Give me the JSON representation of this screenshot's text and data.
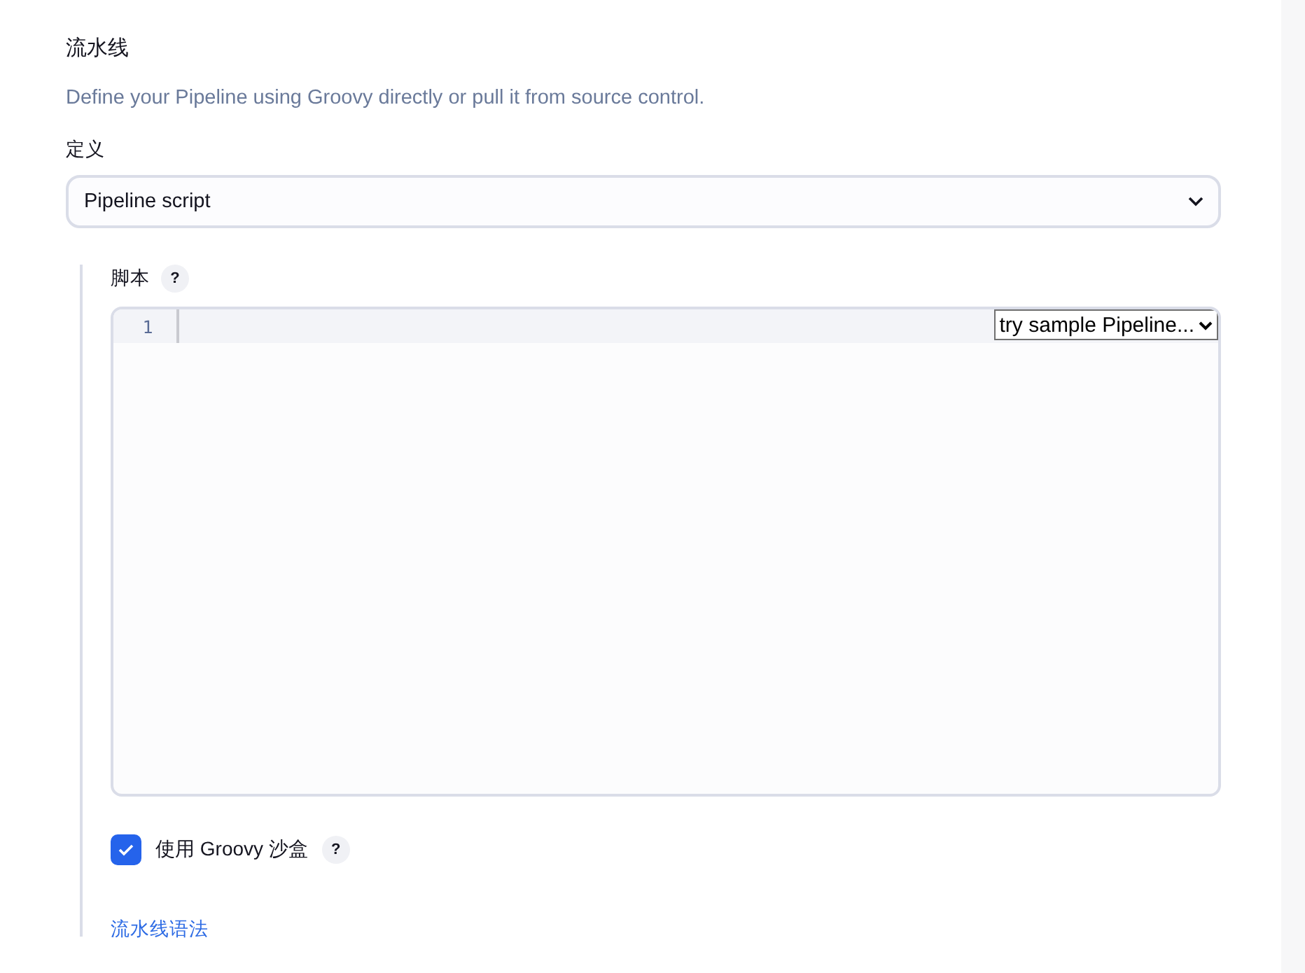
{
  "section": {
    "title": "流水线",
    "description": "Define your Pipeline using Groovy directly or pull it from source control."
  },
  "definition": {
    "label": "定义",
    "value": "Pipeline script"
  },
  "script": {
    "label": "脚本",
    "help": "?",
    "line_numbers": [
      "1"
    ],
    "sample_select": "try sample Pipeline..."
  },
  "sandbox": {
    "label": "使用 Groovy 沙盒",
    "checked": true,
    "help": "?"
  },
  "syntax_link": "流水线语法"
}
